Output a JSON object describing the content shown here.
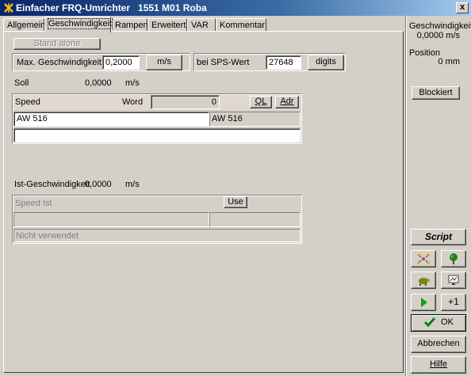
{
  "window": {
    "title": "Einfacher FRQ-Umrichter   1551 M01 Roba",
    "close_label": "x"
  },
  "tabs": [
    {
      "label": "Allgemein",
      "active": false
    },
    {
      "label": "Geschwindigkeit",
      "active": true
    },
    {
      "label": "Rampen",
      "active": false
    },
    {
      "label": "Erweitert",
      "active": false
    },
    {
      "label": "VAR",
      "active": false
    },
    {
      "label": "Kommentar",
      "active": false
    }
  ],
  "main": {
    "stand_alone_label": "Stand alone",
    "max_speed": {
      "label": "Max. Geschwindigkeit",
      "value": "0,2000",
      "unit_button": "m/s"
    },
    "sps": {
      "label": "bei SPS-Wert",
      "value": "27648",
      "unit_button": "digits"
    },
    "soll": {
      "label": "Soll",
      "value": "0,0000",
      "unit": "m/s"
    },
    "speed_group": {
      "name": "Speed",
      "word_label": "Word",
      "word_value": "0",
      "ql_label": "QL",
      "adr_label": "Adr",
      "address": "AW  516",
      "address_ro": "AW  516",
      "comment": ""
    },
    "ist": {
      "label": "Ist-Geschwindigkeit",
      "value": "0,0000",
      "unit": "m/s"
    },
    "speed_ist_group": {
      "name": "Speed Ist",
      "use_label": "Use",
      "field_left": "",
      "field_right": "",
      "status": "Nicht verwendet"
    }
  },
  "side": {
    "speed_label": "Geschwindigkeit",
    "speed_value": "0,0000 m/s",
    "position_label": "Position",
    "position_value": "0 mm",
    "blocked_label": "Blockiert",
    "script_label": "Script",
    "plus_one_label": "+1",
    "ok_label": "OK",
    "cancel_label": "Abbrechen",
    "help_label": "Hilfe",
    "icons": [
      "network-icon",
      "tree-icon",
      "turtle-icon",
      "monitor-icon",
      "play-icon"
    ]
  },
  "colors": {
    "title_start": "#0a246a",
    "title_end": "#a6caf0",
    "face": "#d4d0c8",
    "group_header": "#e0d8d0",
    "ok_check": "#108010",
    "play_green": "#10a010"
  }
}
